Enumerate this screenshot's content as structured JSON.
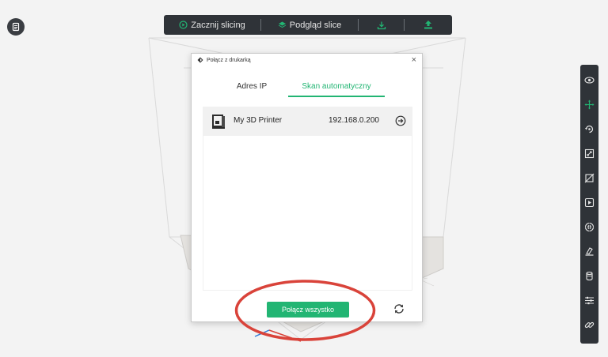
{
  "toolbar": {
    "start_slicing": "Zacznij slicing",
    "preview_slice": "Podgląd slice"
  },
  "dialog": {
    "title": "Połącz z drukarką",
    "close": "×",
    "tabs": [
      {
        "label": "Adres IP",
        "active": false
      },
      {
        "label": "Skan automatyczny",
        "active": true
      }
    ],
    "printers": [
      {
        "name": "My 3D Printer",
        "ip": "192.168.0.200"
      }
    ],
    "connect_all_label": "Połącz wszystko"
  },
  "right_toolbar": {
    "icons": [
      "eye-icon",
      "move-icon",
      "rotate-icon",
      "scale-icon",
      "mirror-icon",
      "lay-flat-icon",
      "support-icon",
      "cut-icon",
      "cylinder-icon",
      "settings-sliders-icon",
      "link-icon"
    ]
  },
  "colors": {
    "accent_green": "#22b573",
    "toolbar_dark": "#2f3338",
    "highlight_red": "#d9433a"
  }
}
